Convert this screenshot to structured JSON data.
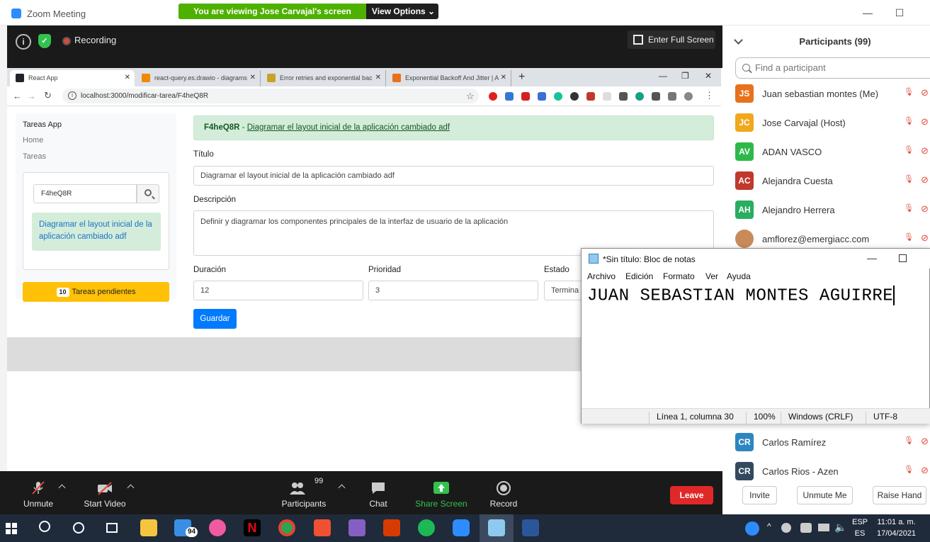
{
  "zoom": {
    "window_title": "Zoom Meeting",
    "viewing_banner": "You are viewing Jose Carvajal's screen",
    "view_options": "View Options ⌄",
    "recording_label": "Recording",
    "enter_full_screen": "Enter Full Screen",
    "toolbar": {
      "unmute": "Unmute",
      "start_video": "Start Video",
      "participants": "Participants",
      "participants_count": "99",
      "chat": "Chat",
      "share_screen": "Share Screen",
      "record": "Record",
      "leave": "Leave"
    }
  },
  "browser": {
    "tabs": [
      {
        "title": "React App"
      },
      {
        "title": "react-query.es.drawio - diagrams"
      },
      {
        "title": "Error retries and exponential bac"
      },
      {
        "title": "Exponential Backoff And Jitter | A"
      }
    ],
    "url": "localhost:3000/modificar-tarea/F4heQ8R"
  },
  "app": {
    "sidebar": {
      "title": "Tareas App",
      "nav_home": "Home",
      "nav_tareas": "Tareas",
      "search_value": "F4heQ8R",
      "result_text": "Diagramar el layout inicial de la aplicación cambiado adf",
      "pending_count": "10",
      "pending_label": "Tareas pendientes"
    },
    "alert": {
      "id": "F4heQ8R",
      "separator": " - ",
      "link_text": "Diagramar el layout inicial de la aplicación cambiado adf"
    },
    "form": {
      "titulo_label": "Título",
      "titulo_value": "Diagramar el layout inicial de la aplicación cambiado adf",
      "descripcion_label": "Descripción",
      "descripcion_value": "Definir y diagramar los componentes principales de la interfaz de usuario de la aplicación",
      "duracion_label": "Duración",
      "duracion_value": "12",
      "prioridad_label": "Prioridad",
      "prioridad_value": "3",
      "estado_label": "Estado",
      "estado_value": "Termina",
      "save_label": "Guardar"
    }
  },
  "participants": {
    "title": "Participants (99)",
    "find_placeholder": "Find a participant",
    "list": [
      {
        "initials": "JS",
        "name": "Juan sebastian montes (Me)",
        "color": "#e8711c"
      },
      {
        "initials": "JC",
        "name": "Jose Carvajal (Host)",
        "color": "#f0a81c"
      },
      {
        "initials": "AV",
        "name": "ADAN VASCO",
        "color": "#2eb84b"
      },
      {
        "initials": "AC",
        "name": "Alejandra Cuesta",
        "color": "#c0392b"
      },
      {
        "initials": "AH",
        "name": "Alejandro Herrera",
        "color": "#27ae60"
      },
      {
        "initials": "",
        "name": "amflorez@emergiacc.com",
        "color": "#c98a5a"
      },
      {
        "initials": "CR",
        "name": "Carlos Ramírez",
        "color": "#2e86c1"
      },
      {
        "initials": "CR",
        "name": "Carlos Rios - Azen",
        "color": "#34495e"
      }
    ],
    "invite": "Invite",
    "unmute_me": "Unmute Me",
    "raise_hand": "Raise Hand"
  },
  "notepad": {
    "title": "*Sin título: Bloc de notas",
    "menu": [
      "Archivo",
      "Edición",
      "Formato",
      "Ver",
      "Ayuda"
    ],
    "content": "JUAN SEBASTIAN MONTES AGUIRRE",
    "status_position": "Línea 1, columna 30",
    "status_zoom": "100%",
    "status_eol": "Windows (CRLF)",
    "status_encoding": "UTF-8"
  },
  "taskbar": {
    "mail_badge": "94",
    "lang_top": "ESP",
    "lang_bottom": "ES",
    "time": "11:01 a. m.",
    "date": "17/04/2021"
  }
}
